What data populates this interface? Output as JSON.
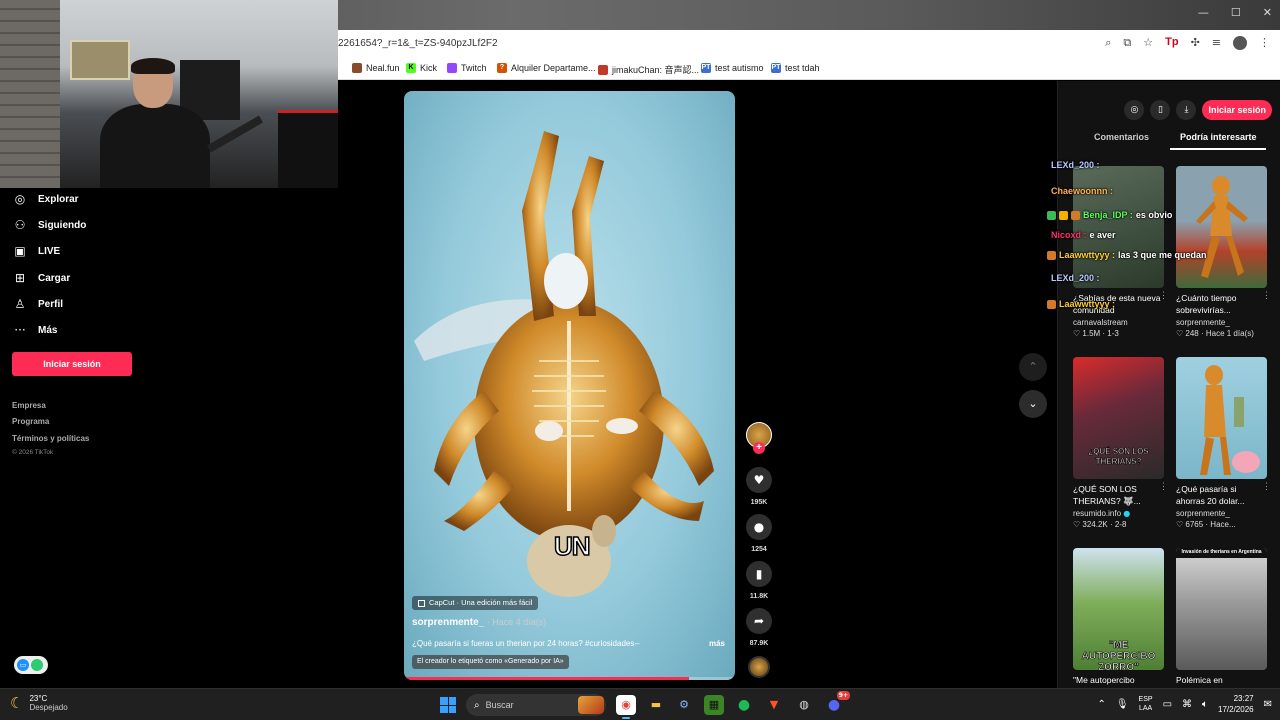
{
  "browser": {
    "url": "2261654?_r=1&_t=ZS-940pzJLf2F2",
    "bookmarks": [
      {
        "label": "Neal.fun",
        "color": "#8a4b2a"
      },
      {
        "label": "Kick",
        "color": "#1a1a1a"
      },
      {
        "label": "Twitch",
        "color": "#9146ff"
      },
      {
        "label": "Alquiler Departame...",
        "color": "#d35400"
      },
      {
        "label": "jimakuChan: 音声認...",
        "color": "#c0392b"
      },
      {
        "label": "test autismo",
        "color": "#3b6fd4"
      },
      {
        "label": "test tdah",
        "color": "#3b6fd4"
      }
    ],
    "tb_icons": {
      "zoom": "⌕",
      "cast": "⧉",
      "star": "☆",
      "ext_tp": "Tp",
      "puzzle": "✣",
      "list": "≡"
    }
  },
  "sidebar": {
    "items": [
      {
        "label": "Explorar",
        "icon": "compass-icon",
        "glyph": "◎"
      },
      {
        "label": "Siguiendo",
        "icon": "following-icon",
        "glyph": "⚇"
      },
      {
        "label": "LIVE",
        "icon": "live-icon",
        "glyph": "▣"
      },
      {
        "label": "Cargar",
        "icon": "upload-icon",
        "glyph": "⊞"
      },
      {
        "label": "Perfil",
        "icon": "profile-icon",
        "glyph": "♙"
      },
      {
        "label": "Más",
        "icon": "more-icon",
        "glyph": "···"
      }
    ],
    "login_label": "Iniciar sesión",
    "footer": [
      "Empresa",
      "Programa",
      "Términos y políticas"
    ],
    "copyright": "© 2026 TikTok"
  },
  "video": {
    "capcut_label": "CapCut · Una edición más fácil",
    "author": "sorprenmente_",
    "time": " · Hace 4 día(s)",
    "caption": "¿Qué pasaría si fueras un therian por 24 horas? #curiosidades--",
    "more": "más",
    "ai_label": "El creador lo etiquetó como «Generado por IA»",
    "overlay_text": "UN",
    "progress": 0.86
  },
  "actions": {
    "likes": "195K",
    "comments": "1254",
    "saves": "11.8K",
    "shares": "87.9K"
  },
  "right_panel": {
    "login_label": "Iniciar sesión",
    "tabs": [
      "Comentarios",
      "Podría interesarte"
    ],
    "cards": [
      {
        "title": "¿Sabías de esta nueva comunidad",
        "author": "carnavalstream",
        "stats": "♡ 1.5M · 1-3",
        "text": ""
      },
      {
        "title": "¿Cuánto tiempo sobrevivirías...",
        "author": "sorprenmente_",
        "stats": "♡ 248 · Hace 1 día(s)",
        "text": ""
      },
      {
        "title": "¿QUÉ SON LOS THERIANS? 🐺...",
        "author": "resumido.info",
        "stats": "♡ 324.2K · 2-8",
        "text": "¿QUÉ SON LOS THERIANS?"
      },
      {
        "title": "¿Qué pasaría si ahorras 20 dolar...",
        "author": "sorprenmente_",
        "stats": "♡ 6765 · Hace...",
        "text": ""
      },
      {
        "title": "\"Me autopercibo",
        "author": "",
        "stats": "",
        "text": "\"ME AUTOPERCIBO ZORRO\""
      },
      {
        "title": "Polémica en",
        "author": "",
        "stats": "",
        "text": "Invasión de therians en Argentina"
      }
    ]
  },
  "chat": [
    {
      "user": "LEXd_200 :",
      "msg": "",
      "color": "#b8c8ff"
    },
    {
      "user": "Chaewoonnn :",
      "msg": "",
      "color": "#ffb14a"
    },
    {
      "user": "Benja_IDP :",
      "msg": "es obvio",
      "color": "#5cff5c"
    },
    {
      "user": "Nicoxd :",
      "msg": "e aver",
      "color": "#ff2d6b"
    },
    {
      "user": "Laawwttyyy :",
      "msg": "las 3 que me quedan",
      "color": "#ffcc33"
    },
    {
      "user": "LEXd_200 :",
      "msg": "",
      "color": "#b8c8ff"
    },
    {
      "user": "Laawwttyyy :",
      "msg": "",
      "color": "#ffcc33"
    }
  ],
  "taskbar": {
    "temp": "23°C",
    "condition": "Despejado",
    "search_placeholder": "Buscar",
    "lang1": "ESP",
    "lang2": "LAA",
    "time": "23:27",
    "date": "17/2/2026",
    "discord_badge": "9+"
  }
}
